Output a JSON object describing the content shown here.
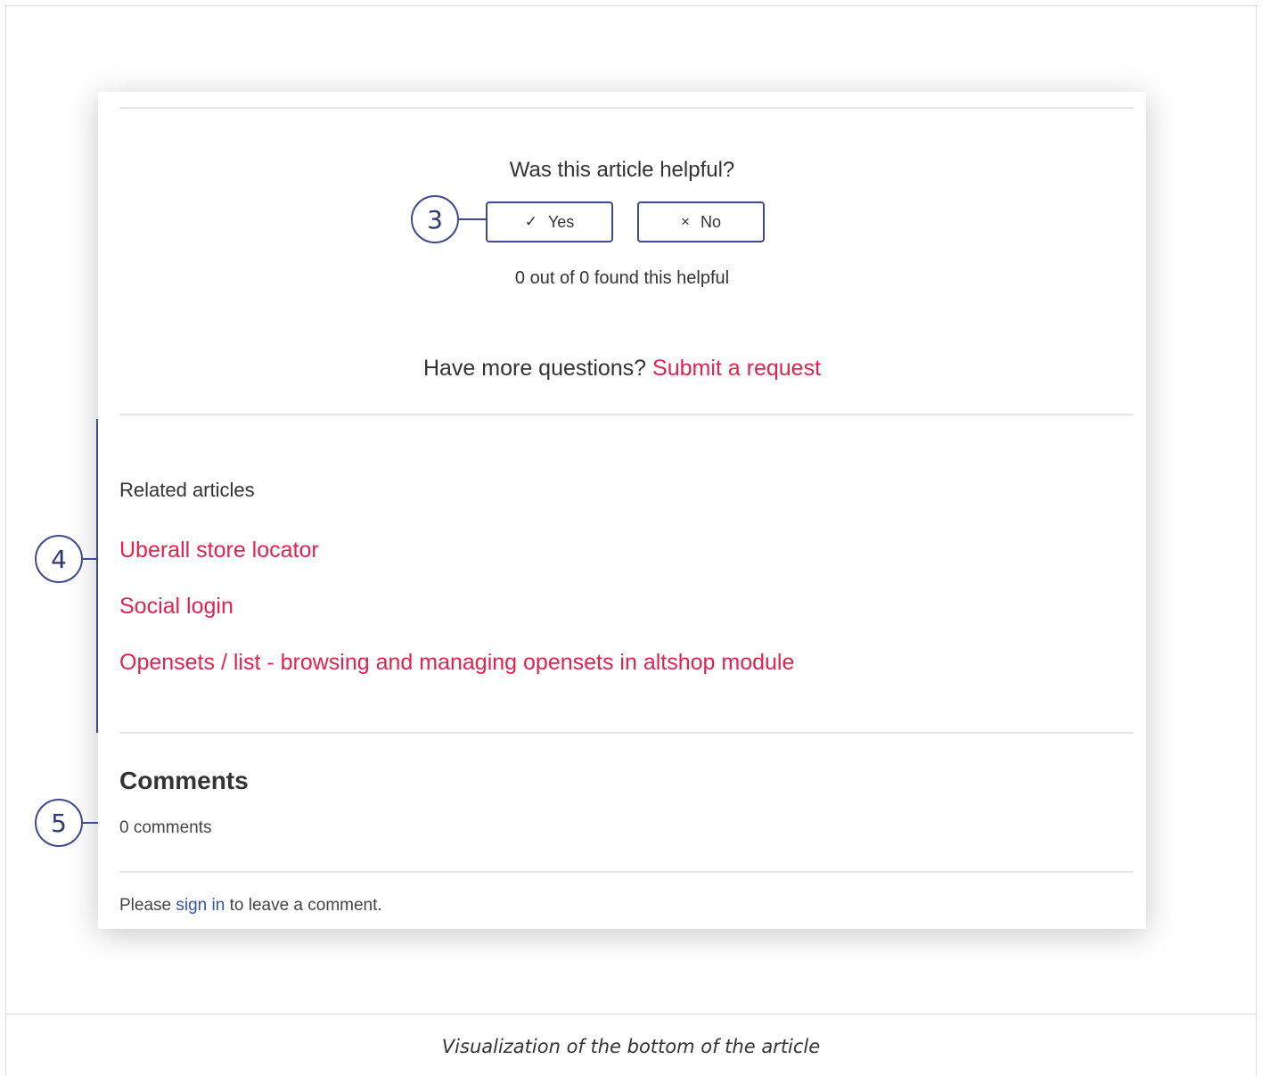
{
  "card": {
    "feedback_question": "Was this article helpful?",
    "yes_button": {
      "icon": "checkmark-icon",
      "glyph": "✓",
      "label": "Yes"
    },
    "no_button": {
      "icon": "x-icon",
      "glyph": "×",
      "label": "No"
    },
    "helpful_count": "0 out of 0 found this helpful",
    "more_questions": {
      "text": "Have more questions?",
      "link": "Submit a request"
    },
    "related": {
      "title": "Related articles",
      "items": [
        "Uberall store locator",
        "Social login",
        "Opensets / list - browsing and managing opensets in altshop module"
      ]
    },
    "comments": {
      "title": "Comments",
      "count": "0 comments",
      "signin_prefix": "Please",
      "signin_link": "sign in",
      "signin_suffix": "to leave a comment."
    }
  },
  "callouts": [
    "3",
    "4",
    "5"
  ],
  "caption": "Visualization of the bottom of the article",
  "colors": {
    "link_red": "#e0234f",
    "link_blue": "#3553b8",
    "callout_blue": "#3c4b8c"
  }
}
